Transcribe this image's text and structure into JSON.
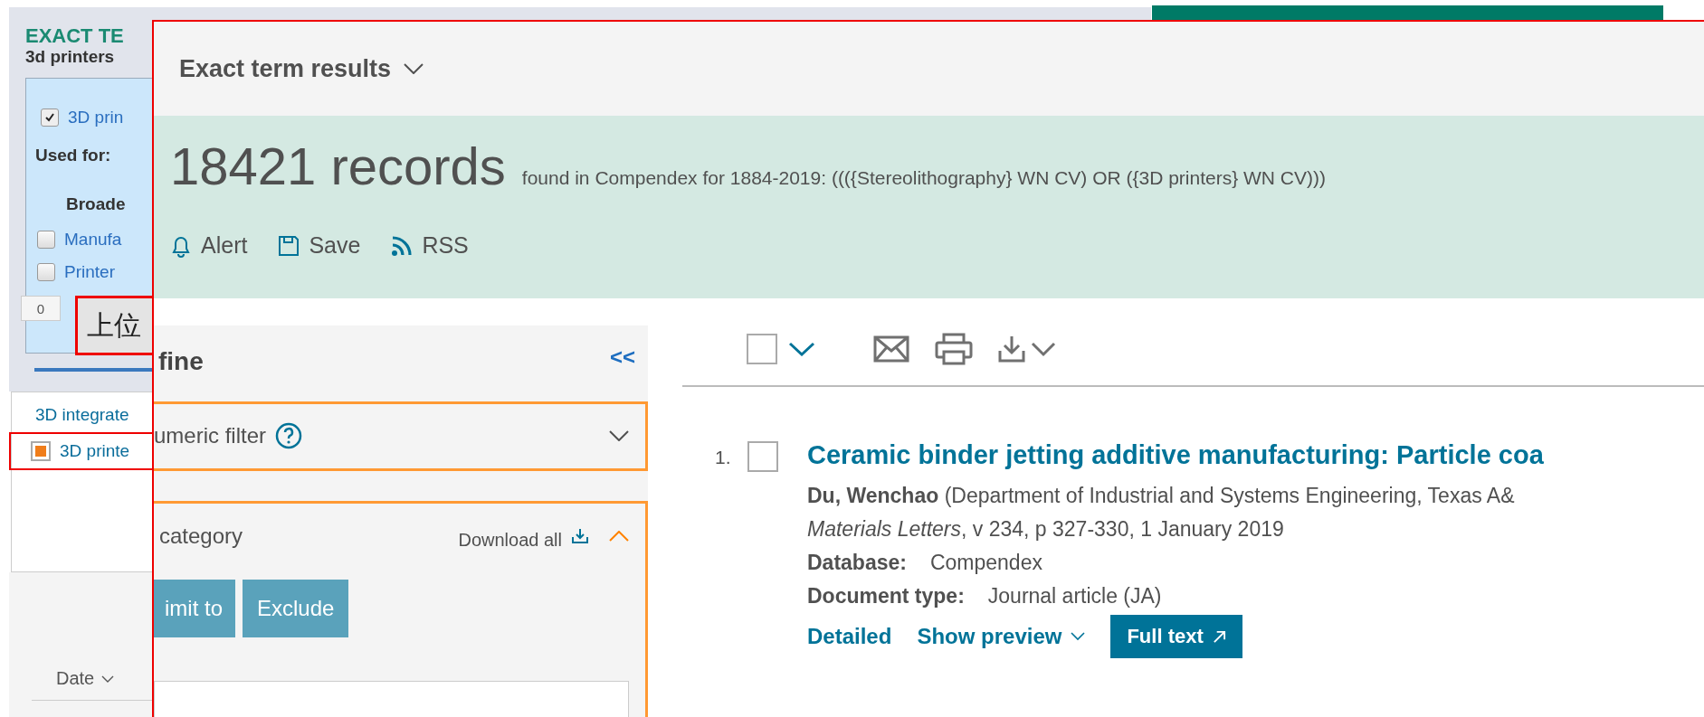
{
  "background_window": {
    "heading": "EXACT TE",
    "term": "3d printers",
    "term_box": {
      "preferred": {
        "label": "3D prin",
        "checked": true
      },
      "used_for_label": "Used for:",
      "broader_label": "Broade",
      "broader_terms": [
        {
          "label": "Manufa",
          "checked": false
        },
        {
          "label": "Printer",
          "checked": false
        }
      ]
    },
    "count": "0",
    "add_button": "上位",
    "term_list": [
      {
        "label": "3D integrate",
        "selected": false
      },
      {
        "label": "3D printe",
        "selected": true
      }
    ],
    "sort_label": "Date"
  },
  "front_window": {
    "title": "Exact term results",
    "count": "18421 records",
    "query": "found in Compendex for 1884-2019: ((({Stereolithography} WN CV) OR ({3D printers} WN CV)))",
    "actions": [
      {
        "label": "Alert",
        "kind": "alert"
      },
      {
        "label": "Save",
        "kind": "save"
      },
      {
        "label": "RSS",
        "kind": "rss"
      }
    ],
    "refine": {
      "title": "fine",
      "collapse": "<<",
      "sections": [
        {
          "title": "umeric filter",
          "help": true,
          "expanded": false
        },
        {
          "title": "category",
          "help": false,
          "expanded": true,
          "download_label": "Download all",
          "buttons": [
            "imit to",
            "Exclude"
          ]
        }
      ]
    },
    "toolbar": {
      "select_all_checked": false
    },
    "results": [
      {
        "number": "1.",
        "checked": false,
        "title": "Ceramic binder jetting additive manufacturing: Particle coa",
        "byline": "**Du, Wenchao** (Department of Industrial and Systems Engineering, Texas A&",
        "source": "*Materials Letters*, v 234, p 327-330, 1 January 2019",
        "fields": [
          {
            "label": "Database:",
            "value": "Compendex"
          },
          {
            "label": "Document type:",
            "value": "Journal article (JA)"
          }
        ],
        "links": [
          "Detailed",
          "Show preview"
        ],
        "full_text": "Full text"
      }
    ]
  }
}
